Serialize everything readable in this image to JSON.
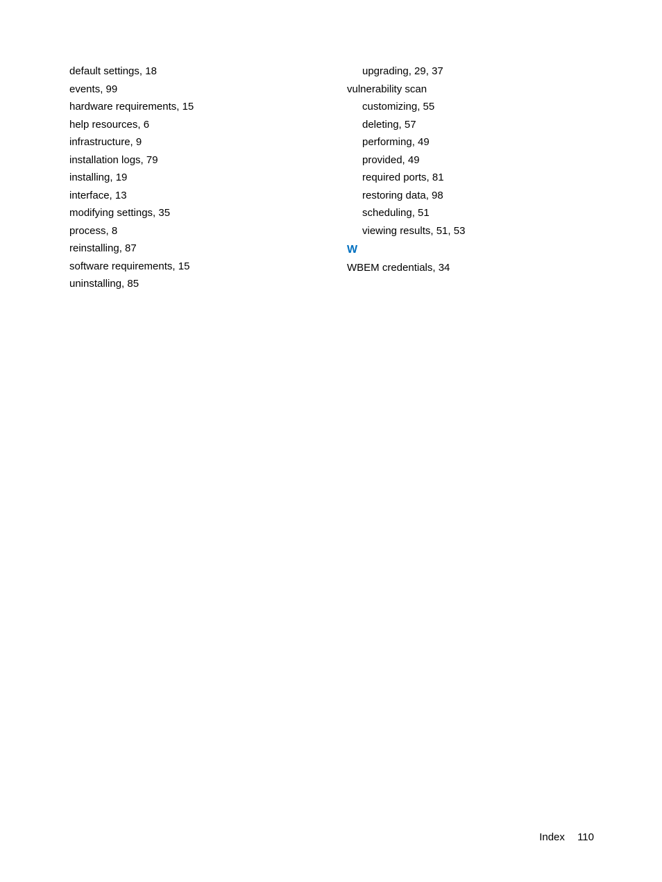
{
  "leftColumn": {
    "entries": [
      {
        "text": "default settings, 18",
        "sub": false
      },
      {
        "text": "events, 99",
        "sub": false
      },
      {
        "text": "hardware requirements, 15",
        "sub": false
      },
      {
        "text": "help resources, 6",
        "sub": false
      },
      {
        "text": "infrastructure, 9",
        "sub": false
      },
      {
        "text": "installation logs, 79",
        "sub": false
      },
      {
        "text": "installing, 19",
        "sub": false
      },
      {
        "text": "interface, 13",
        "sub": false
      },
      {
        "text": "modifying settings, 35",
        "sub": false
      },
      {
        "text": "process, 8",
        "sub": false
      },
      {
        "text": "reinstalling, 87",
        "sub": false
      },
      {
        "text": "software requirements, 15",
        "sub": false
      },
      {
        "text": "uninstalling, 85",
        "sub": false
      }
    ]
  },
  "rightColumn": {
    "preEntries": [
      {
        "text": "upgrading, 29, 37",
        "sub": true
      }
    ],
    "topic": "vulnerability scan",
    "topicSubs": [
      {
        "text": "customizing, 55",
        "sub": true
      },
      {
        "text": "deleting, 57",
        "sub": true
      },
      {
        "text": "performing, 49",
        "sub": true
      },
      {
        "text": "provided, 49",
        "sub": true
      },
      {
        "text": "required ports, 81",
        "sub": true
      },
      {
        "text": "restoring data, 98",
        "sub": true
      },
      {
        "text": "scheduling, 51",
        "sub": true
      },
      {
        "text": "viewing results, 51, 53",
        "sub": true
      }
    ],
    "sectionHeading": "W",
    "sectionEntries": [
      {
        "text": "WBEM credentials, 34",
        "sub": false
      }
    ]
  },
  "footer": {
    "label": "Index",
    "pageNumber": "110"
  }
}
